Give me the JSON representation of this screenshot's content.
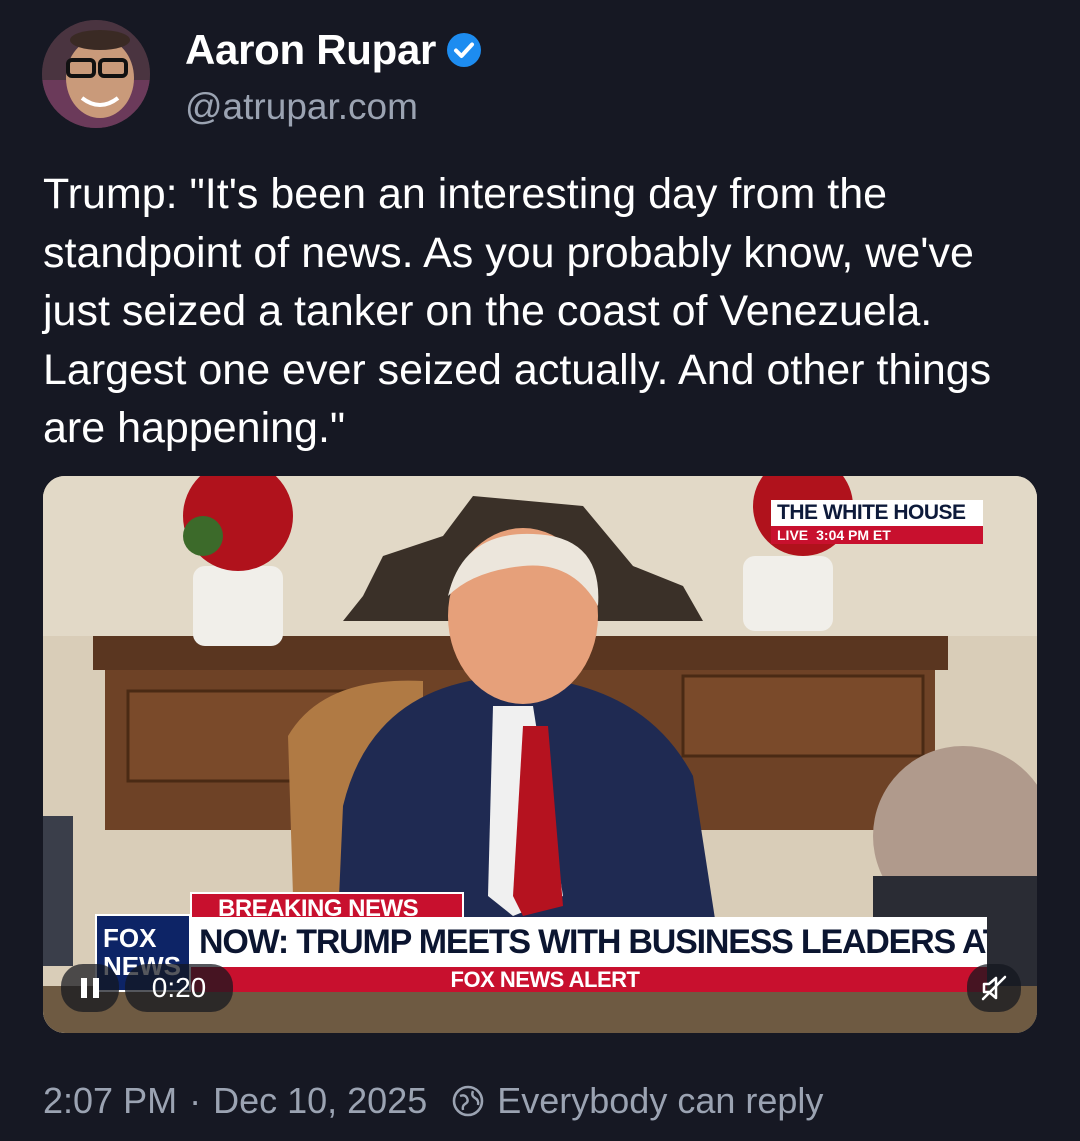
{
  "author": {
    "name": "Aaron Rupar",
    "handle": "@atrupar.com",
    "verified_icon": "verified-check-icon",
    "avatar_icon": "avatar-photo"
  },
  "post": {
    "text": "Trump: \"It's been an interesting day from the standpoint of news. As you probably know, we've just seized a tanker on the coast of Venezuela. Largest one ever seized actually. And other things are happening.\""
  },
  "video": {
    "broadcast": {
      "location": "THE WHITE HOUSE",
      "live": "LIVE",
      "time": "3:04 PM ET",
      "breaking": "BREAKING NEWS",
      "headline": "NOW: TRUMP MEETS WITH BUSINESS LEADERS AT WH",
      "alert": "FOX NEWS ALERT",
      "logo": "FOX NEWS"
    },
    "timer": "0:20",
    "pause_icon": "pause-icon",
    "mute_icon": "muted-speaker-icon"
  },
  "footer": {
    "time": "2:07 PM",
    "separator": "·",
    "date": "Dec 10, 2025",
    "reply_setting": "Everybody can reply",
    "reply_icon": "globe-icon"
  },
  "colors": {
    "background": "#161823",
    "verified": "#1d8cf0",
    "secondary_text": "#9ba3b2",
    "fox_red": "#c8102e"
  }
}
